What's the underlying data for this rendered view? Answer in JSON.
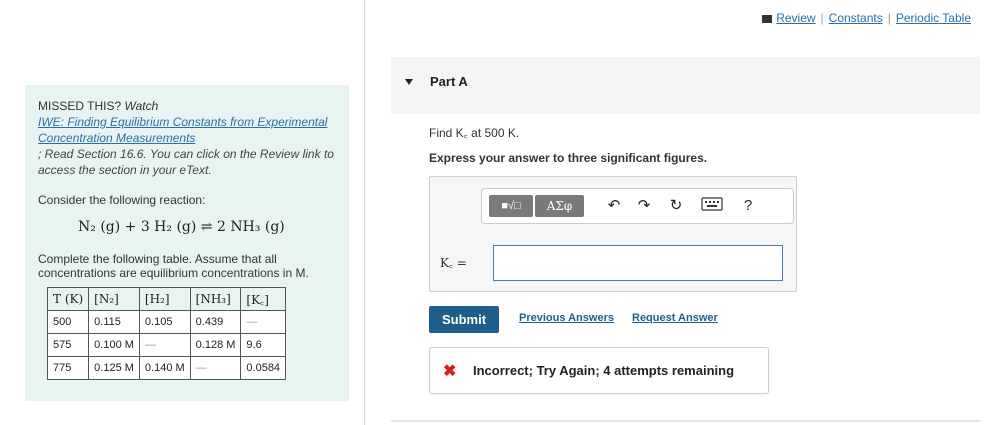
{
  "top_links": {
    "review": "Review",
    "constants": "Constants",
    "periodic_table": "Periodic Table",
    "sep": "|"
  },
  "left_panel": {
    "missed_label": "MISSED THIS?",
    "watch": "Watch",
    "video_link": "IWE: Finding Equilibrium Constants from Experimental Concentration Measurements",
    "read_text": "; Read Section 16.6. You can click on the Review link to access the section in your eText.",
    "consider": "Consider the following reaction:",
    "equation": "N₂ (g) + 3 H₂ (g) ⇌ 2 NH₃ (g)",
    "complete": "Complete the following table. Assume that all concentrations are equilibrium concentrations in M.",
    "table": {
      "headers": [
        "T (K)",
        "[N₂]",
        "[H₂]",
        "[NH₃]",
        "[K꜀]"
      ],
      "rows": [
        [
          "500",
          "0.115",
          "0.105",
          "0.439",
          "—"
        ],
        [
          "575",
          "0.100 M",
          "—",
          "0.128 M",
          "9.6"
        ],
        [
          "775",
          "0.125 M",
          "0.140 M",
          "—",
          "0.0584"
        ]
      ]
    }
  },
  "part": {
    "title": "Part A"
  },
  "question": {
    "find": "Find K꜀ at 500 K.",
    "express": "Express your answer to three significant figures."
  },
  "answer_box": {
    "toolbar": {
      "template_btn": "■√□",
      "greek_btn": "ΑΣφ",
      "help": "?"
    },
    "kc_label": "K꜀ =",
    "kc_value": ""
  },
  "actions": {
    "submit": "Submit",
    "previous_answers": "Previous Answers",
    "request_answer": "Request Answer"
  },
  "feedback": {
    "icon": "✖",
    "text": "Incorrect; Try Again; 4 attempts remaining"
  },
  "colors": {
    "accent": "#1d5f8a",
    "panel_bg": "#e8f4f2",
    "error": "#d21f1f",
    "link": "#2a6fa8"
  }
}
